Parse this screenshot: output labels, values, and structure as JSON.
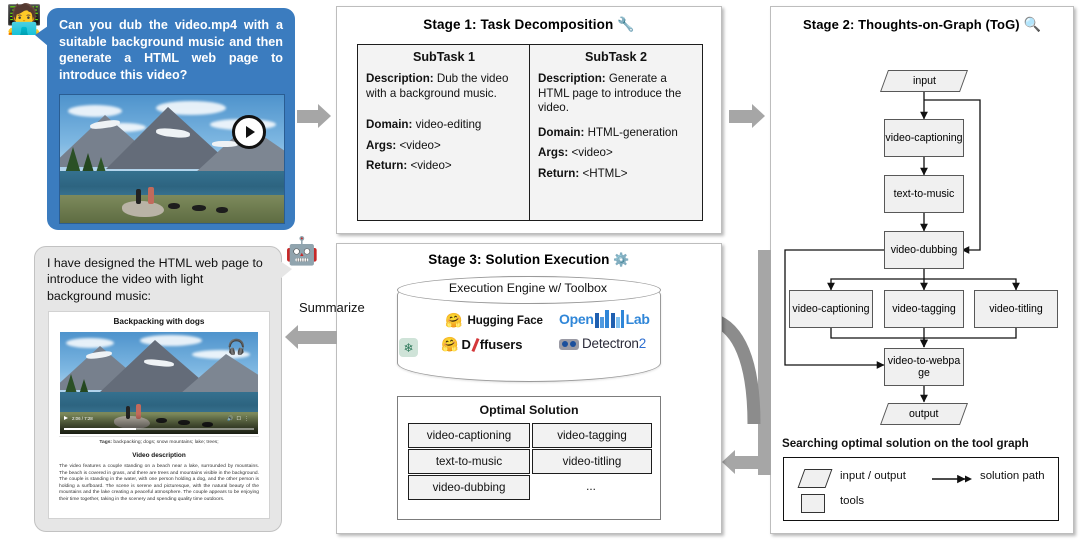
{
  "user": {
    "avatar_icon": "person-with-laptop-emoji",
    "avatar_glyph": "🧑‍💻",
    "question": "Can you dub the video.mp4 with a suitable background music and then generate a HTML web page to introduce this video?",
    "bubble_color": "#3b7cbf",
    "video_play_icon": "play-button-icon"
  },
  "stage1": {
    "title": "Stage 1: Task Decomposition",
    "icon": "wrench-icon",
    "icon_glyph": "🔧",
    "subtasks": [
      {
        "name": "SubTask 1",
        "fields": [
          {
            "label": "Description:",
            "value": " Dub the video with a background music."
          },
          {
            "label": "Domain:",
            "value": " video-editing"
          },
          {
            "label": "Args:",
            "value": " <video>"
          },
          {
            "label": "Return:",
            "value": " <video>"
          }
        ]
      },
      {
        "name": "SubTask 2",
        "fields": [
          {
            "label": "Description:",
            "value": " Generate a HTML page to introduce the video."
          },
          {
            "label": "Domain:",
            "value": " HTML-generation"
          },
          {
            "label": "Args:",
            "value": " <video>"
          },
          {
            "label": "Return:",
            "value": " <HTML>"
          }
        ]
      }
    ]
  },
  "stage2": {
    "title": "Stage 2: Thoughts-on-Graph (ToG)",
    "icon": "magnifying-glass-icon",
    "icon_glyph": "🔍",
    "nodes": {
      "input": "input",
      "video_captioning_top": "video-captioning",
      "text_to_music": "text-to-music",
      "video_dubbing": "video-dubbing",
      "video_captioning_branch": "video-captioning",
      "video_tagging": "video-tagging",
      "video_titling": "video-titling",
      "video_to_webpage": "video-to-webpage",
      "output": "output"
    },
    "caption": "Searching optimal solution on the tool graph",
    "legend": {
      "io_label": "input / output",
      "tools_label": "tools",
      "path_label": "solution path"
    }
  },
  "stage3": {
    "title": "Stage 3: Solution Execution",
    "icon": "gear-icon",
    "icon_glyph": "⚙️",
    "engine_title": "Execution Engine w/ Toolbox",
    "toolbox": [
      {
        "name": "hugging-face-logo",
        "label": "Hugging Face"
      },
      {
        "name": "openmmlab-logo",
        "label": "OpenMMLab"
      },
      {
        "name": "openai-logo",
        "label": ""
      },
      {
        "name": "diffusers-logo",
        "label": "Diffusers"
      },
      {
        "name": "detectron2-logo",
        "label": "Detectron2"
      }
    ],
    "optimal_solution": {
      "title": "Optimal Solution",
      "items": [
        "video-captioning",
        "video-tagging",
        "text-to-music",
        "video-titling",
        "video-dubbing",
        "..."
      ]
    }
  },
  "result": {
    "robot_icon": "robot-emoji",
    "robot_glyph": "🤖",
    "text": "I have designed the HTML web page to introduce the video  with light background music:",
    "webpage": {
      "title": "Backpacking with dogs",
      "headphone_icon": "headphones-icon",
      "headphone_glyph": "🎧",
      "player_time": "2:06 / 7:28",
      "tags_label": "Tags:",
      "tags_value": " backpacking; dogs; snow mountains; lake; trees;",
      "description_heading": "Video description",
      "description": "The video features a couple standing on a beach near a lake, surrounded by mountains. The beach is covered in grass, and there are trees and mountains visible in the background. The couple is standing in the water, with one person holding a dog, and the other person is holding a surfboard. The scene is serene and picturesque, with the natural beauty of the mountains and the lake creating a peaceful atmosphere. The couple appears to be enjoying their time together, taking in the scenery and spending quality time outdoors."
    }
  },
  "arrows": {
    "summarize_label": "Summarize",
    "color": "#a6a6a6"
  }
}
